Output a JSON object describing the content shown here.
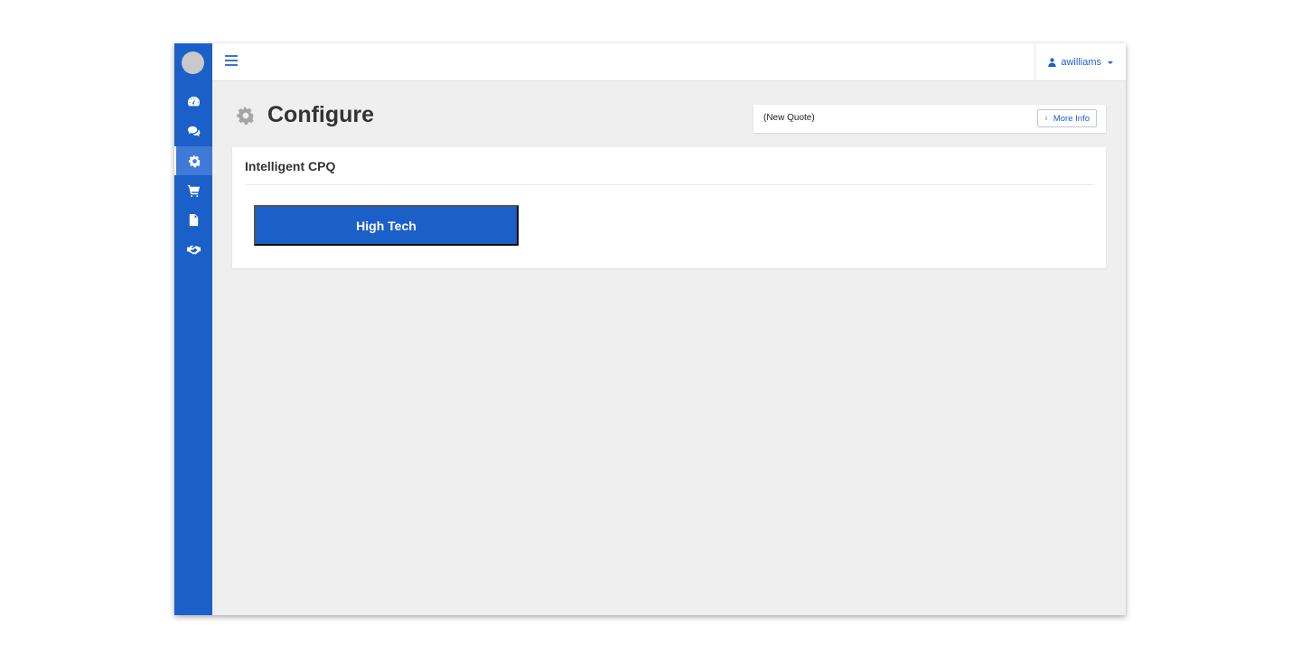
{
  "sidebar": {
    "accent": "#1b60c9",
    "items": [
      {
        "icon": "dashboard-icon"
      },
      {
        "icon": "comments-icon"
      },
      {
        "icon": "gear-icon",
        "active": true
      },
      {
        "icon": "cart-icon"
      },
      {
        "icon": "document-icon"
      },
      {
        "icon": "handshake-icon"
      }
    ]
  },
  "header": {
    "menu_icon": "hamburger-icon",
    "user": {
      "icon": "user-icon",
      "name": "awilliams"
    }
  },
  "page": {
    "icon": "gear-icon",
    "title": "Configure"
  },
  "quote": {
    "name": "(New Quote)",
    "more_info_label": "More Info"
  },
  "panel": {
    "title": "Intelligent CPQ",
    "categories": [
      {
        "label": "High Tech"
      }
    ]
  }
}
